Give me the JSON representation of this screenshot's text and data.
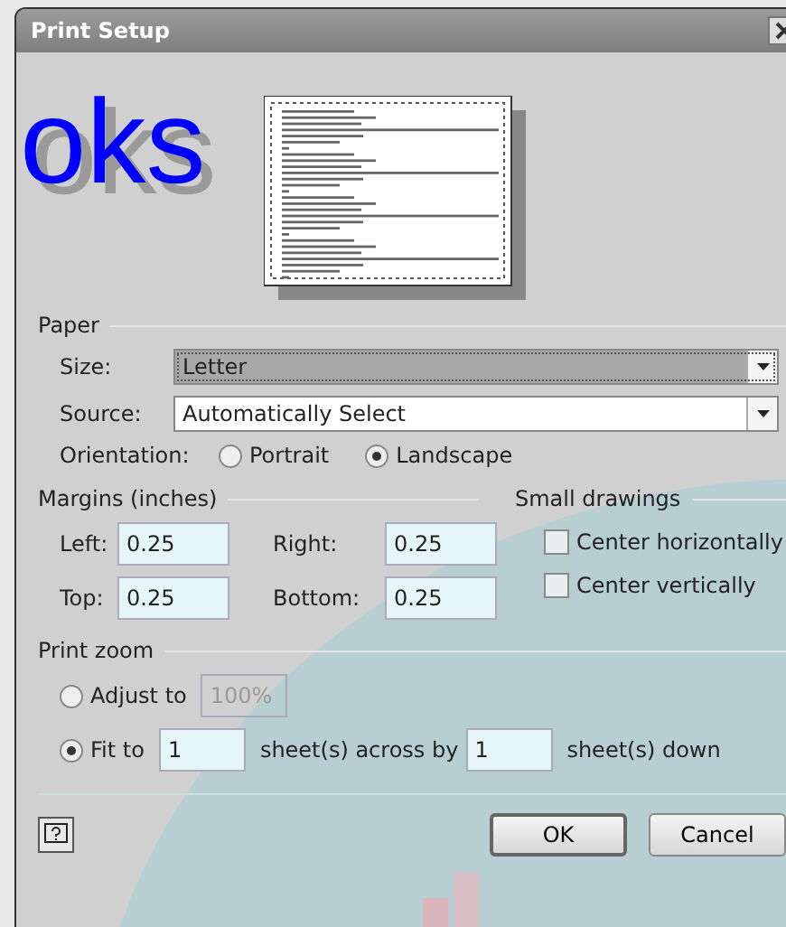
{
  "window": {
    "title": "Print Setup"
  },
  "background_text": "oks",
  "paper": {
    "heading": "Paper",
    "size": {
      "label": "Size:",
      "value": "Letter",
      "focused": true
    },
    "source": {
      "label": "Source:",
      "value": "Automatically Select",
      "focused": false
    },
    "orientation": {
      "label": "Orientation:",
      "options": [
        {
          "label": "Portrait",
          "selected": false
        },
        {
          "label": "Landscape",
          "selected": true
        }
      ]
    }
  },
  "margins": {
    "heading": "Margins (inches)",
    "fields": [
      {
        "label": "Left:",
        "value": "0.25"
      },
      {
        "label": "Right:",
        "value": "0.25"
      },
      {
        "label": "Top:",
        "value": "0.25"
      },
      {
        "label": "Bottom:",
        "value": "0.25"
      }
    ]
  },
  "small_drawings": {
    "heading": "Small drawings",
    "options": [
      {
        "label": "Center horizontally",
        "checked": false
      },
      {
        "label": "Center vertically",
        "checked": false
      }
    ]
  },
  "print_zoom": {
    "heading": "Print zoom",
    "adjust": {
      "label": "Adjust to",
      "value": "100%",
      "selected": false,
      "disabled": true
    },
    "fit": {
      "label": "Fit to",
      "selected": true,
      "across": "1",
      "across_label": "sheet(s) across by",
      "down": "1",
      "down_label": "sheet(s) down"
    }
  },
  "buttons": [
    {
      "label": "OK",
      "default": true
    },
    {
      "label": "Cancel",
      "default": false
    }
  ]
}
